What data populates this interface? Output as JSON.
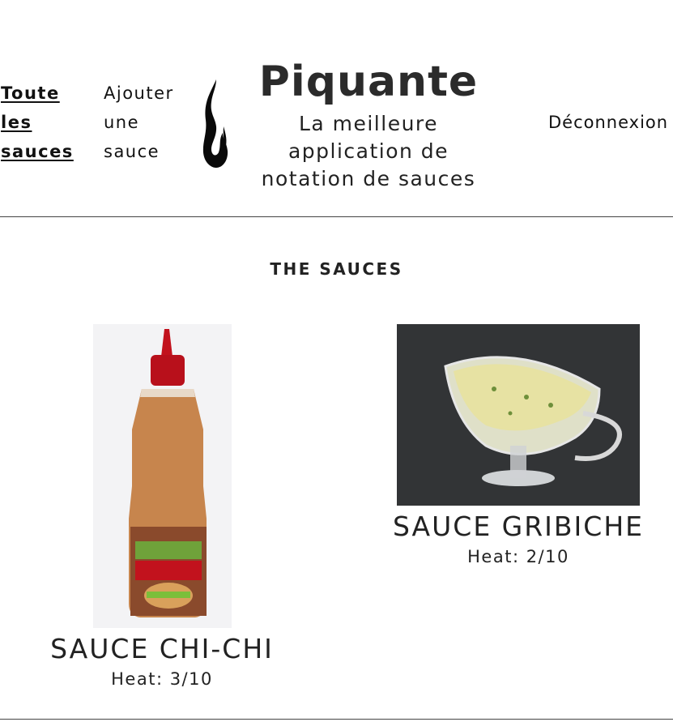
{
  "nav": {
    "all_sauces": "Toute les sauces",
    "add_sauce": "Ajouter une sauce",
    "logout": "Déconnexion"
  },
  "brand": {
    "title": "Piquante",
    "tagline": "La meilleure application de notation de sauces",
    "logo_icon": "flame-icon"
  },
  "main": {
    "section_title": "THE SAUCES",
    "sauces": [
      {
        "name": "SAUCE CHI-CHI",
        "heat": "Heat: 3/10",
        "image": "hamburger-sauce-bottle"
      },
      {
        "name": "SAUCE GRIBICHE",
        "heat": "Heat: 2/10",
        "image": "sauce-boat-gribiche"
      }
    ]
  },
  "colors": {
    "text": "#222222",
    "divider": "#444444",
    "background": "#ffffff"
  }
}
